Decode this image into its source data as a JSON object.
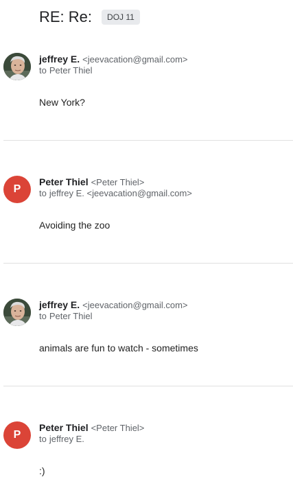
{
  "thread": {
    "subject": "RE: Re:",
    "label": "DOJ 11"
  },
  "messages": [
    {
      "sender_name": "jeffrey E.",
      "sender_email": "<jeevacation@gmail.com>",
      "to_prefix": "to",
      "to": "Peter Thiel",
      "body": "New York?",
      "avatar_type": "photo"
    },
    {
      "sender_name": "Peter Thiel",
      "sender_email": "<Peter Thiel>",
      "to_prefix": "to",
      "to": "jeffrey E. <jeevacation@gmail.com>",
      "body": "Avoiding the zoo",
      "avatar_type": "letter",
      "avatar_letter": "P"
    },
    {
      "sender_name": "jeffrey E.",
      "sender_email": "<jeevacation@gmail.com>",
      "to_prefix": "to",
      "to": "Peter Thiel",
      "body": "animals are fun to watch - sometimes",
      "avatar_type": "photo"
    },
    {
      "sender_name": "Peter Thiel",
      "sender_email": "<Peter Thiel>",
      "to_prefix": "to",
      "to": "jeffrey E.",
      "body": ":)",
      "avatar_type": "letter",
      "avatar_letter": "P"
    }
  ],
  "colors": {
    "letter_avatar": "#db4437",
    "label_chip_bg": "#e8eaed",
    "divider": "#e0e0e0",
    "secondary_text": "#5f6368"
  }
}
